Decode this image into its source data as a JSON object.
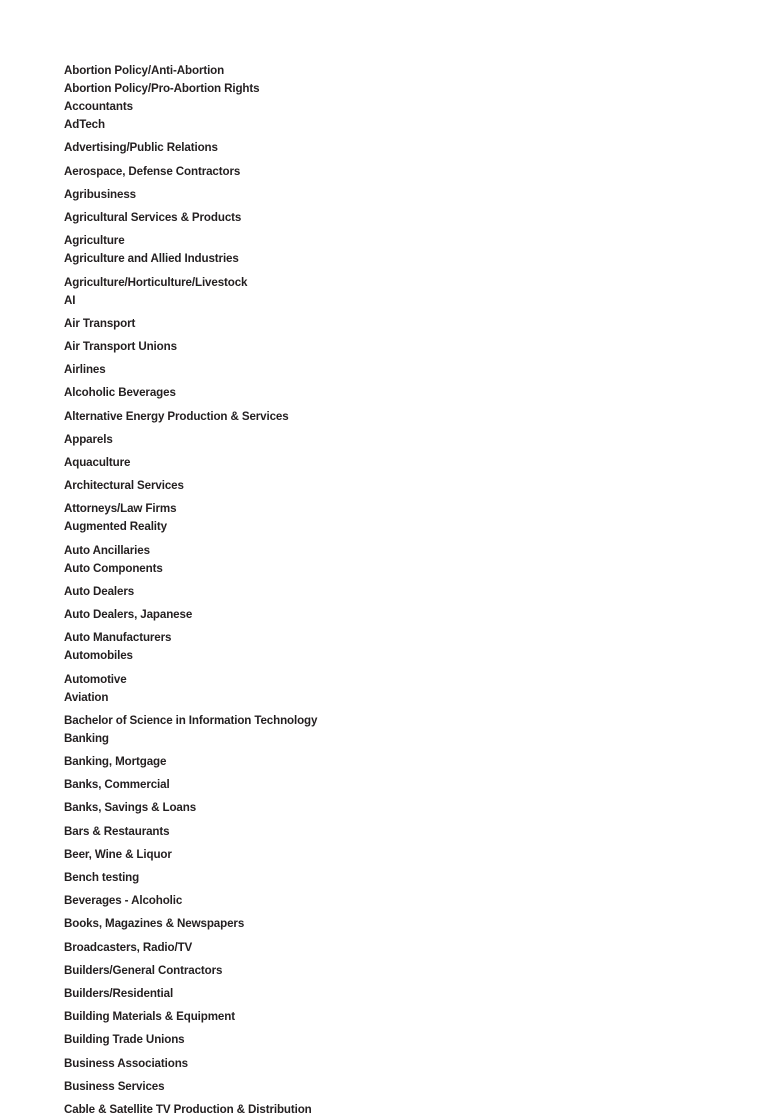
{
  "document": {
    "background_color": "#ffffff",
    "text_color": "#231f20",
    "title": "Industry Categories List"
  },
  "list": {
    "name": "industry-categories",
    "items": [
      {
        "label": "Abortion Policy/Anti-Abortion",
        "gap_before": false
      },
      {
        "label": "Abortion Policy/Pro-Abortion Rights",
        "gap_before": false
      },
      {
        "label": "Accountants",
        "gap_before": false
      },
      {
        "label": "AdTech",
        "gap_before": false
      },
      {
        "label": "Advertising/Public Relations",
        "gap_before": true
      },
      {
        "label": "Aerospace, Defense Contractors",
        "gap_before": true
      },
      {
        "label": "Agribusiness",
        "gap_before": true
      },
      {
        "label": "Agricultural Services & Products",
        "gap_before": true
      },
      {
        "label": "Agriculture",
        "gap_before": true
      },
      {
        "label": "Agriculture and Allied Industries",
        "gap_before": false
      },
      {
        "label": "Agriculture/Horticulture/Livestock",
        "gap_before": true
      },
      {
        "label": "AI",
        "gap_before": false
      },
      {
        "label": "Air Transport",
        "gap_before": true
      },
      {
        "label": "Air Transport Unions",
        "gap_before": true
      },
      {
        "label": "Airlines",
        "gap_before": true
      },
      {
        "label": "Alcoholic Beverages",
        "gap_before": true
      },
      {
        "label": "Alternative Energy Production & Services",
        "gap_before": true
      },
      {
        "label": "Apparels",
        "gap_before": true
      },
      {
        "label": "Aquaculture",
        "gap_before": true
      },
      {
        "label": "Architectural Services",
        "gap_before": true
      },
      {
        "label": "Attorneys/Law Firms",
        "gap_before": true
      },
      {
        "label": "Augmented Reality",
        "gap_before": false
      },
      {
        "label": "Auto Ancillaries",
        "gap_before": true
      },
      {
        "label": "Auto Components",
        "gap_before": false
      },
      {
        "label": "Auto Dealers",
        "gap_before": true
      },
      {
        "label": "Auto Dealers, Japanese",
        "gap_before": true
      },
      {
        "label": "Auto Manufacturers",
        "gap_before": true
      },
      {
        "label": "Automobiles",
        "gap_before": false
      },
      {
        "label": "Automotive",
        "gap_before": true
      },
      {
        "label": "Aviation",
        "gap_before": false
      },
      {
        "label": "Bachelor of Science in Information Technology",
        "gap_before": true
      },
      {
        "label": "Banking",
        "gap_before": false
      },
      {
        "label": "Banking, Mortgage",
        "gap_before": true
      },
      {
        "label": "Banks, Commercial",
        "gap_before": true
      },
      {
        "label": "Banks, Savings & Loans",
        "gap_before": true
      },
      {
        "label": "Bars & Restaurants",
        "gap_before": true
      },
      {
        "label": "Beer, Wine & Liquor",
        "gap_before": true
      },
      {
        "label": "Bench testing",
        "gap_before": true
      },
      {
        "label": "Beverages - Alcoholic",
        "gap_before": true
      },
      {
        "label": "Books, Magazines & Newspapers",
        "gap_before": true
      },
      {
        "label": "Broadcasters, Radio/TV",
        "gap_before": true
      },
      {
        "label": "Builders/General Contractors",
        "gap_before": true
      },
      {
        "label": "Builders/Residential",
        "gap_before": true
      },
      {
        "label": "Building Materials & Equipment",
        "gap_before": true
      },
      {
        "label": "Building Trade Unions",
        "gap_before": true
      },
      {
        "label": "Business Associations",
        "gap_before": true
      },
      {
        "label": "Business Services",
        "gap_before": true
      },
      {
        "label": "Cable & Satellite TV Production & Distribution",
        "gap_before": true
      }
    ]
  }
}
